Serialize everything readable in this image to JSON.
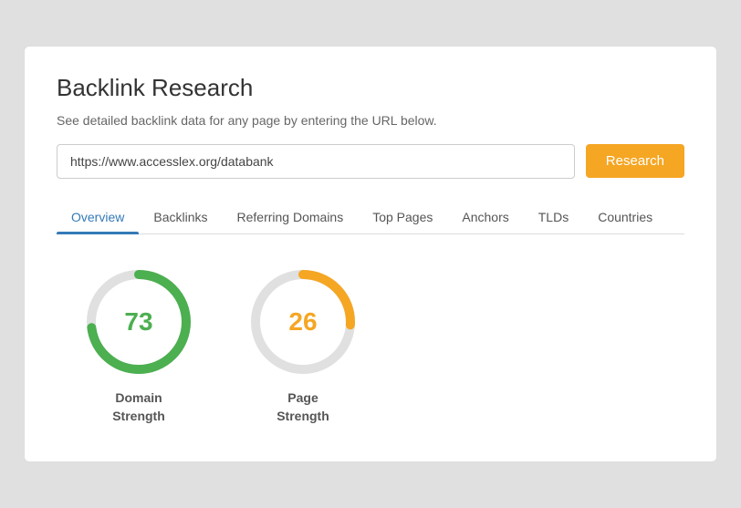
{
  "page": {
    "title": "Backlink Research",
    "subtitle": "See detailed backlink data for any page by entering the URL below.",
    "url_value": "https://www.accesslex.org/databank",
    "url_placeholder": "Enter URL",
    "research_button": "Research"
  },
  "tabs": [
    {
      "id": "overview",
      "label": "Overview",
      "active": true
    },
    {
      "id": "backlinks",
      "label": "Backlinks",
      "active": false
    },
    {
      "id": "referring-domains",
      "label": "Referring Domains",
      "active": false
    },
    {
      "id": "top-pages",
      "label": "Top Pages",
      "active": false
    },
    {
      "id": "anchors",
      "label": "Anchors",
      "active": false
    },
    {
      "id": "tlds",
      "label": "TLDs",
      "active": false
    },
    {
      "id": "countries",
      "label": "Countries",
      "active": false
    }
  ],
  "metrics": [
    {
      "id": "domain-strength",
      "value": "73",
      "label_line1": "Domain",
      "label_line2": "Strength",
      "color": "#4caf50",
      "track_color": "#e0e0e0",
      "percent": 73
    },
    {
      "id": "page-strength",
      "value": "26",
      "label_line1": "Page",
      "label_line2": "Strength",
      "color": "#f5a623",
      "track_color": "#e0e0e0",
      "percent": 26
    }
  ],
  "colors": {
    "active_tab": "#337ab7",
    "research_btn": "#f5a623",
    "domain_strength_color": "#4caf50",
    "page_strength_color": "#f5a623"
  }
}
